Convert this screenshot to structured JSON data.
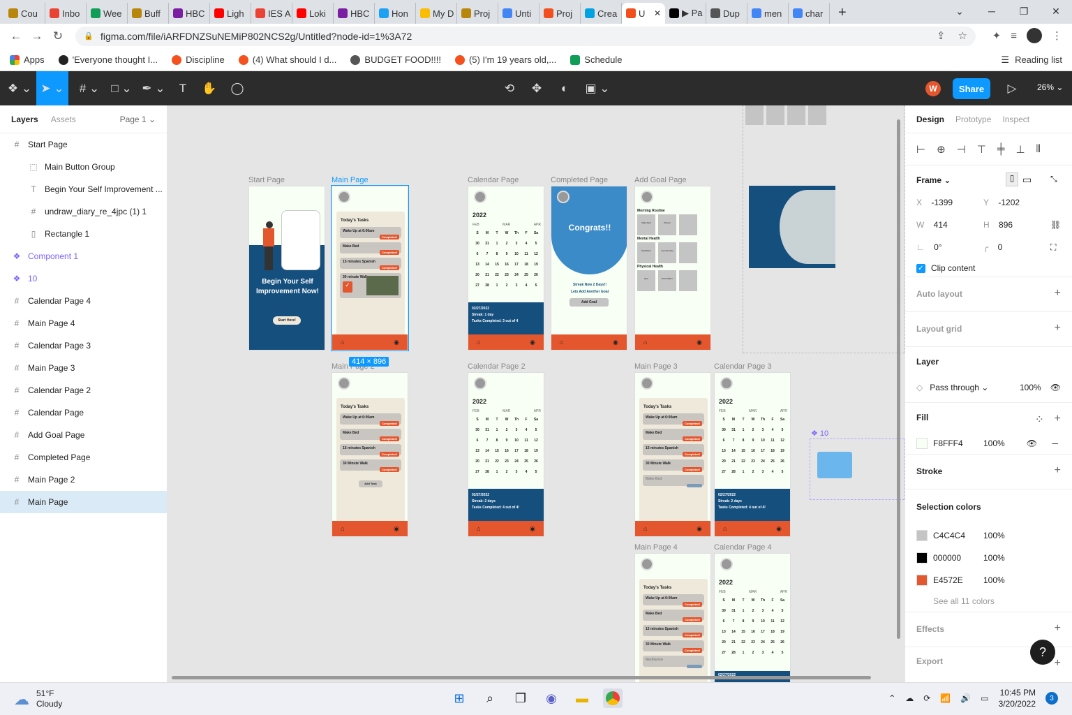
{
  "browser": {
    "tabs": [
      {
        "title": "Cou",
        "color": "#b8860b"
      },
      {
        "title": "Inbo",
        "color": "#ea4335"
      },
      {
        "title": "Wee",
        "color": "#0f9d58"
      },
      {
        "title": "Buff",
        "color": "#b8860b"
      },
      {
        "title": "HBC",
        "color": "#7b1fa2"
      },
      {
        "title": "Ligh",
        "color": "#ff0000"
      },
      {
        "title": "IES A",
        "color": "#ea4335"
      },
      {
        "title": "Loki",
        "color": "#ff0000"
      },
      {
        "title": "HBC",
        "color": "#7b1fa2"
      },
      {
        "title": "Hon",
        "color": "#1da1f2"
      },
      {
        "title": "My D",
        "color": "#fbbc04"
      },
      {
        "title": "Proj",
        "color": "#b8860b"
      },
      {
        "title": "Unti",
        "color": "#4285f4"
      },
      {
        "title": "Proj",
        "color": "#f24e1e"
      },
      {
        "title": "Crea",
        "color": "#00a3e0"
      },
      {
        "title": "U",
        "color": "#f24e1e"
      },
      {
        "title": "▶ Pa",
        "color": "#000000"
      },
      {
        "title": "Dup",
        "color": "#555555"
      },
      {
        "title": "men",
        "color": "#4285f4"
      },
      {
        "title": "char",
        "color": "#4285f4"
      }
    ],
    "url": "figma.com/file/iARFDNZSuNEMiP802NCS2g/Untitled?node-id=1%3A72",
    "bookmarks": [
      {
        "label": "Apps"
      },
      {
        "label": "'Everyone thought I..."
      },
      {
        "label": "Discipline"
      },
      {
        "label": "(4) What should I d..."
      },
      {
        "label": "BUDGET FOOD!!!!"
      },
      {
        "label": "(5) I'm 19 years old,..."
      },
      {
        "label": "Schedule"
      }
    ],
    "reading_list": "Reading list"
  },
  "figma": {
    "share_label": "Share",
    "avatar_letter": "W",
    "zoom": "26%",
    "left_panel": {
      "tab_layers": "Layers",
      "tab_assets": "Assets",
      "page": "Page 1",
      "layers": [
        {
          "name": "Start Page",
          "icon": "#",
          "type": "frame"
        },
        {
          "name": "Main Button Group",
          "icon": "⬚",
          "type": "child"
        },
        {
          "name": "Begin Your Self Improvement ...",
          "icon": "T",
          "type": "child"
        },
        {
          "name": "undraw_diary_re_4jpc (1) 1",
          "icon": "#",
          "type": "child"
        },
        {
          "name": "Rectangle 1",
          "icon": "▯",
          "type": "child"
        },
        {
          "name": "Component 1",
          "icon": "❖",
          "type": "comp"
        },
        {
          "name": "10",
          "icon": "❖",
          "type": "comp"
        },
        {
          "name": "Calendar Page 4",
          "icon": "#",
          "type": "frame"
        },
        {
          "name": "Main Page 4",
          "icon": "#",
          "type": "frame"
        },
        {
          "name": "Calendar Page 3",
          "icon": "#",
          "type": "frame"
        },
        {
          "name": "Main Page 3",
          "icon": "#",
          "type": "frame"
        },
        {
          "name": "Calendar Page 2",
          "icon": "#",
          "type": "frame"
        },
        {
          "name": "Calendar Page",
          "icon": "#",
          "type": "frame"
        },
        {
          "name": "Add Goal Page",
          "icon": "#",
          "type": "frame"
        },
        {
          "name": "Completed Page",
          "icon": "#",
          "type": "frame"
        },
        {
          "name": "Main Page 2",
          "icon": "#",
          "type": "frame"
        },
        {
          "name": "Main Page",
          "icon": "#",
          "type": "sel"
        }
      ]
    },
    "right_panel": {
      "tab_design": "Design",
      "tab_prototype": "Prototype",
      "tab_inspect": "Inspect",
      "frame_label": "Frame",
      "x_label": "X",
      "x": "-1399",
      "y_label": "Y",
      "y": "-1202",
      "w_label": "W",
      "w": "414",
      "h_label": "H",
      "h": "896",
      "rotation": "0°",
      "radius": "0",
      "clip_content": "Clip content",
      "auto_layout": "Auto layout",
      "layout_grid": "Layout grid",
      "layer_title": "Layer",
      "blend": "Pass through",
      "layer_opacity": "100%",
      "fill_title": "Fill",
      "fill_hex": "F8FFF4",
      "fill_opacity": "100%",
      "stroke_title": "Stroke",
      "selection_colors_title": "Selection colors",
      "selection_colors": [
        {
          "hex": "C4C4C4",
          "opacity": "100%",
          "swatch": "#c4c4c4"
        },
        {
          "hex": "000000",
          "opacity": "100%",
          "swatch": "#000000"
        },
        {
          "hex": "E4572E",
          "opacity": "100%",
          "swatch": "#e4572e"
        }
      ],
      "see_all": "See all 11 colors",
      "effects": "Effects",
      "export": "Export"
    },
    "canvas": {
      "labels": {
        "start": "Start Page",
        "main": "Main Page",
        "calendar": "Calendar Page",
        "completed": "Completed Page",
        "addgoal": "Add Goal Page",
        "main2": "Main Page 2",
        "calendar2": "Calendar Page 2",
        "main3": "Main Page 3",
        "calendar3": "Calendar Page 3",
        "main4": "Main Page 4",
        "calendar4": "Calendar Page 4",
        "comp10": "10"
      },
      "selection_size": "414 × 896",
      "start_title": "Begin Your Self Improvement Now!",
      "start_button": "Start Here!",
      "todays_tasks": "Today's Tasks",
      "tasks": [
        "Wake Up at 6:00am",
        "Make Bed",
        "15 minutes Spanish",
        "30 minute Walk"
      ],
      "tasks2": [
        "Wake Up at 6:00am",
        "Make Bed",
        "15 minutes Spanish",
        "30 Minute Walk"
      ],
      "completed_badge": "Completed!",
      "add_task": "Add Task",
      "year": "2022",
      "months": [
        "FEB",
        "MAR",
        "APR"
      ],
      "weekdays": [
        "S",
        "M",
        "T",
        "W",
        "Th",
        "F",
        "Sa"
      ],
      "streak1": "Streak:  1 day",
      "tasks_completed1": "Tasks Completed:  3 out of 4",
      "streak2": "Streak:  2 days",
      "tasks_completed2": "Tasks Completed: 4 out of 4!",
      "date": "02/27/2022",
      "congrats": "Congrats!!",
      "streak_now": "Streak Now 2 Days!!",
      "lets_add": "Lets Add Another Goal",
      "add_goal": "Add Goal",
      "morning": "Morning Routine",
      "mental": "Mental Health",
      "physical": "Physical Health",
      "goals_morning": [
        "Make Bed",
        "Shower"
      ],
      "goals_mental": [
        "Meditation",
        "Journal Entry"
      ],
      "goals_physical": [
        "Gym",
        "Drink Water"
      ],
      "meditation": "Meditation",
      "make_bed": "Make Bed"
    }
  },
  "taskbar": {
    "temp": "51°F",
    "condition": "Cloudy",
    "time": "10:45 PM",
    "date": "3/20/2022",
    "notifications": "3"
  }
}
